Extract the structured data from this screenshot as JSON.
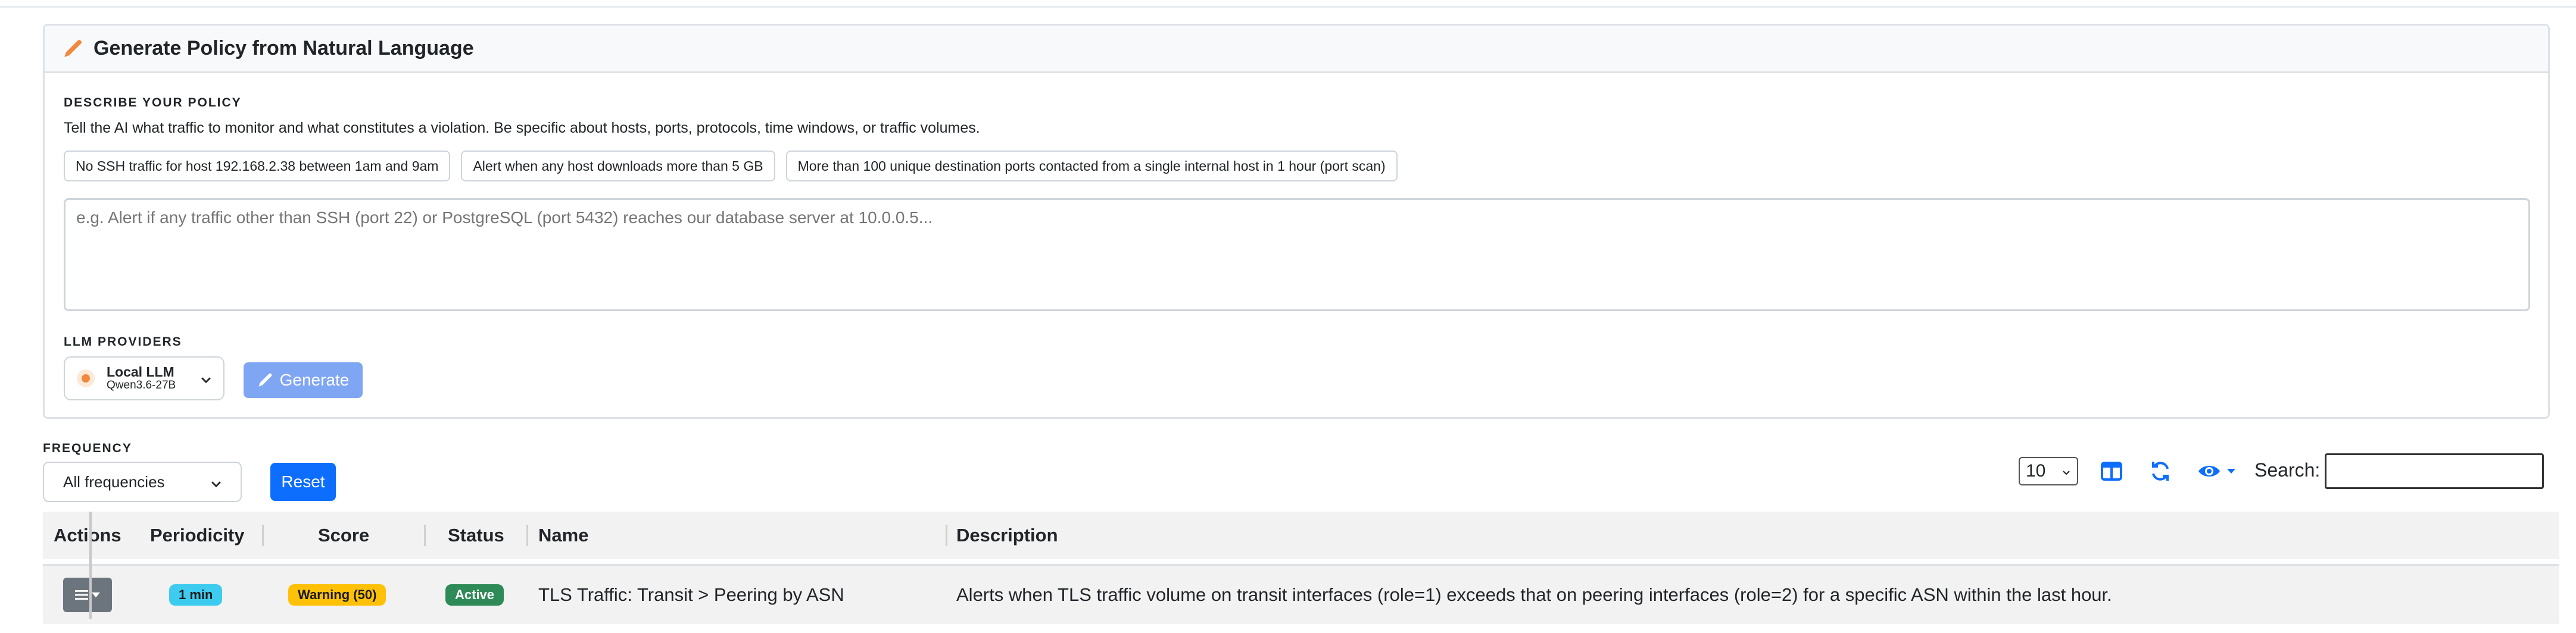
{
  "header": {
    "title": "Generate Policy from Natural Language"
  },
  "describe": {
    "label": "DESCRIBE YOUR POLICY",
    "help": "Tell the AI what traffic to monitor and what constitutes a violation. Be specific about hosts, ports, protocols, time windows, or traffic volumes.",
    "examples": [
      "No SSH traffic for host 192.168.2.38 between 1am and 9am",
      "Alert when any host downloads more than 5 GB",
      "More than 100 unique destination ports contacted from a single internal host in 1 hour (port scan)"
    ],
    "placeholder": "e.g. Alert if any traffic other than SSH (port 22) or PostgreSQL (port 5432) reaches our database server at 10.0.0.5..."
  },
  "llm": {
    "label": "LLM PROVIDERS",
    "provider_name": "Local LLM",
    "provider_model": "Qwen3.6-27B",
    "generate_label": "Generate"
  },
  "filters": {
    "frequency_label": "FREQUENCY",
    "frequency_value": "All frequencies",
    "reset_label": "Reset"
  },
  "toolbar": {
    "page_length": "10",
    "search_label": "Search:",
    "search_value": ""
  },
  "table": {
    "columns": [
      "Actions",
      "Periodicity",
      "Score",
      "Status",
      "Name",
      "Description"
    ],
    "rows": [
      {
        "periodicity": "1 min",
        "score": "Warning (50)",
        "status": "Active",
        "name": "TLS Traffic: Transit > Peering by ASN",
        "description": "Alerts when TLS traffic volume on transit interfaces (role=1) exceeds that on peering interfaces (role=2) for a specific ASN within the last hour."
      }
    ]
  },
  "colors": {
    "primary": "#0d6efd",
    "generate_disabled": "#7fa6f3",
    "periodicity_badge": "#3dcbf0",
    "score_badge": "#ffc107",
    "status_badge": "#2e8b57",
    "pencil": "#f0883e"
  },
  "icons": [
    "pencil-icon",
    "chevron-down-icon",
    "columns-icon",
    "refresh-icon",
    "eye-icon",
    "list-icon",
    "caret-down-icon"
  ]
}
